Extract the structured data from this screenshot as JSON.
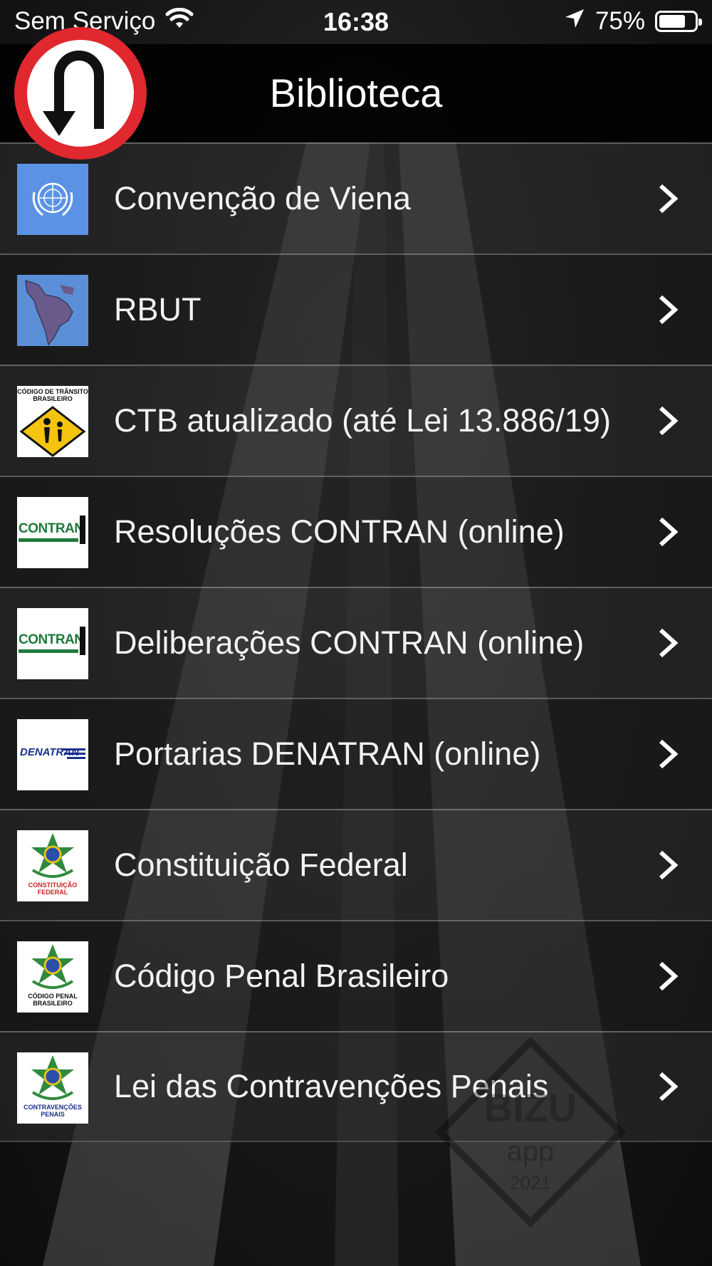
{
  "status_bar": {
    "carrier": "Sem Serviço",
    "time": "16:38",
    "battery_percent_text": "75%",
    "battery_level": 0.75,
    "icons": [
      "wifi-icon",
      "location-arrow-icon",
      "battery-icon"
    ]
  },
  "nav": {
    "title": "Biblioteca",
    "back_icon": "u-turn-sign-icon"
  },
  "items": [
    {
      "label": "Convenção de Viena",
      "icon": "un-emblem-icon"
    },
    {
      "label": "RBUT",
      "icon": "south-america-map-icon"
    },
    {
      "label": "CTB atualizado (até Lei 13.886/19)",
      "icon": "ctb-school-crossing-icon",
      "icon_text": "CÓDIGO DE TRÂNSITO BRASILEIRO"
    },
    {
      "label": "Resoluções CONTRAN (online)",
      "icon": "contran-logo-icon",
      "icon_text": "CONTRAN"
    },
    {
      "label": "Deliberações CONTRAN (online)",
      "icon": "contran-logo-icon",
      "icon_text": "CONTRAN"
    },
    {
      "label": "Portarias DENATRAN (online)",
      "icon": "denatran-logo-icon",
      "icon_text": "DENATRAN"
    },
    {
      "label": "Constituição Federal",
      "icon": "brazil-coat-of-arms-icon",
      "icon_text": "CONSTITUIÇÃO FEDERAL"
    },
    {
      "label": "Código Penal Brasileiro",
      "icon": "brazil-coat-of-arms-icon",
      "icon_text": "CÓDIGO PENAL BRASILEIRO"
    },
    {
      "label": "Lei das Contravenções Penais",
      "icon": "brazil-coat-of-arms-icon",
      "icon_text": "CONTRAVENÇÕES PENAIS"
    }
  ],
  "watermark": {
    "brand": "BIZU",
    "sub": "app",
    "year": "2021"
  },
  "colors": {
    "sign_red": "#e0282e",
    "un_blue": "#5b92e5",
    "contran_green": "#1f7a3a",
    "denatran_blue": "#1a2f8a",
    "ctb_yellow": "#f4c40f"
  }
}
